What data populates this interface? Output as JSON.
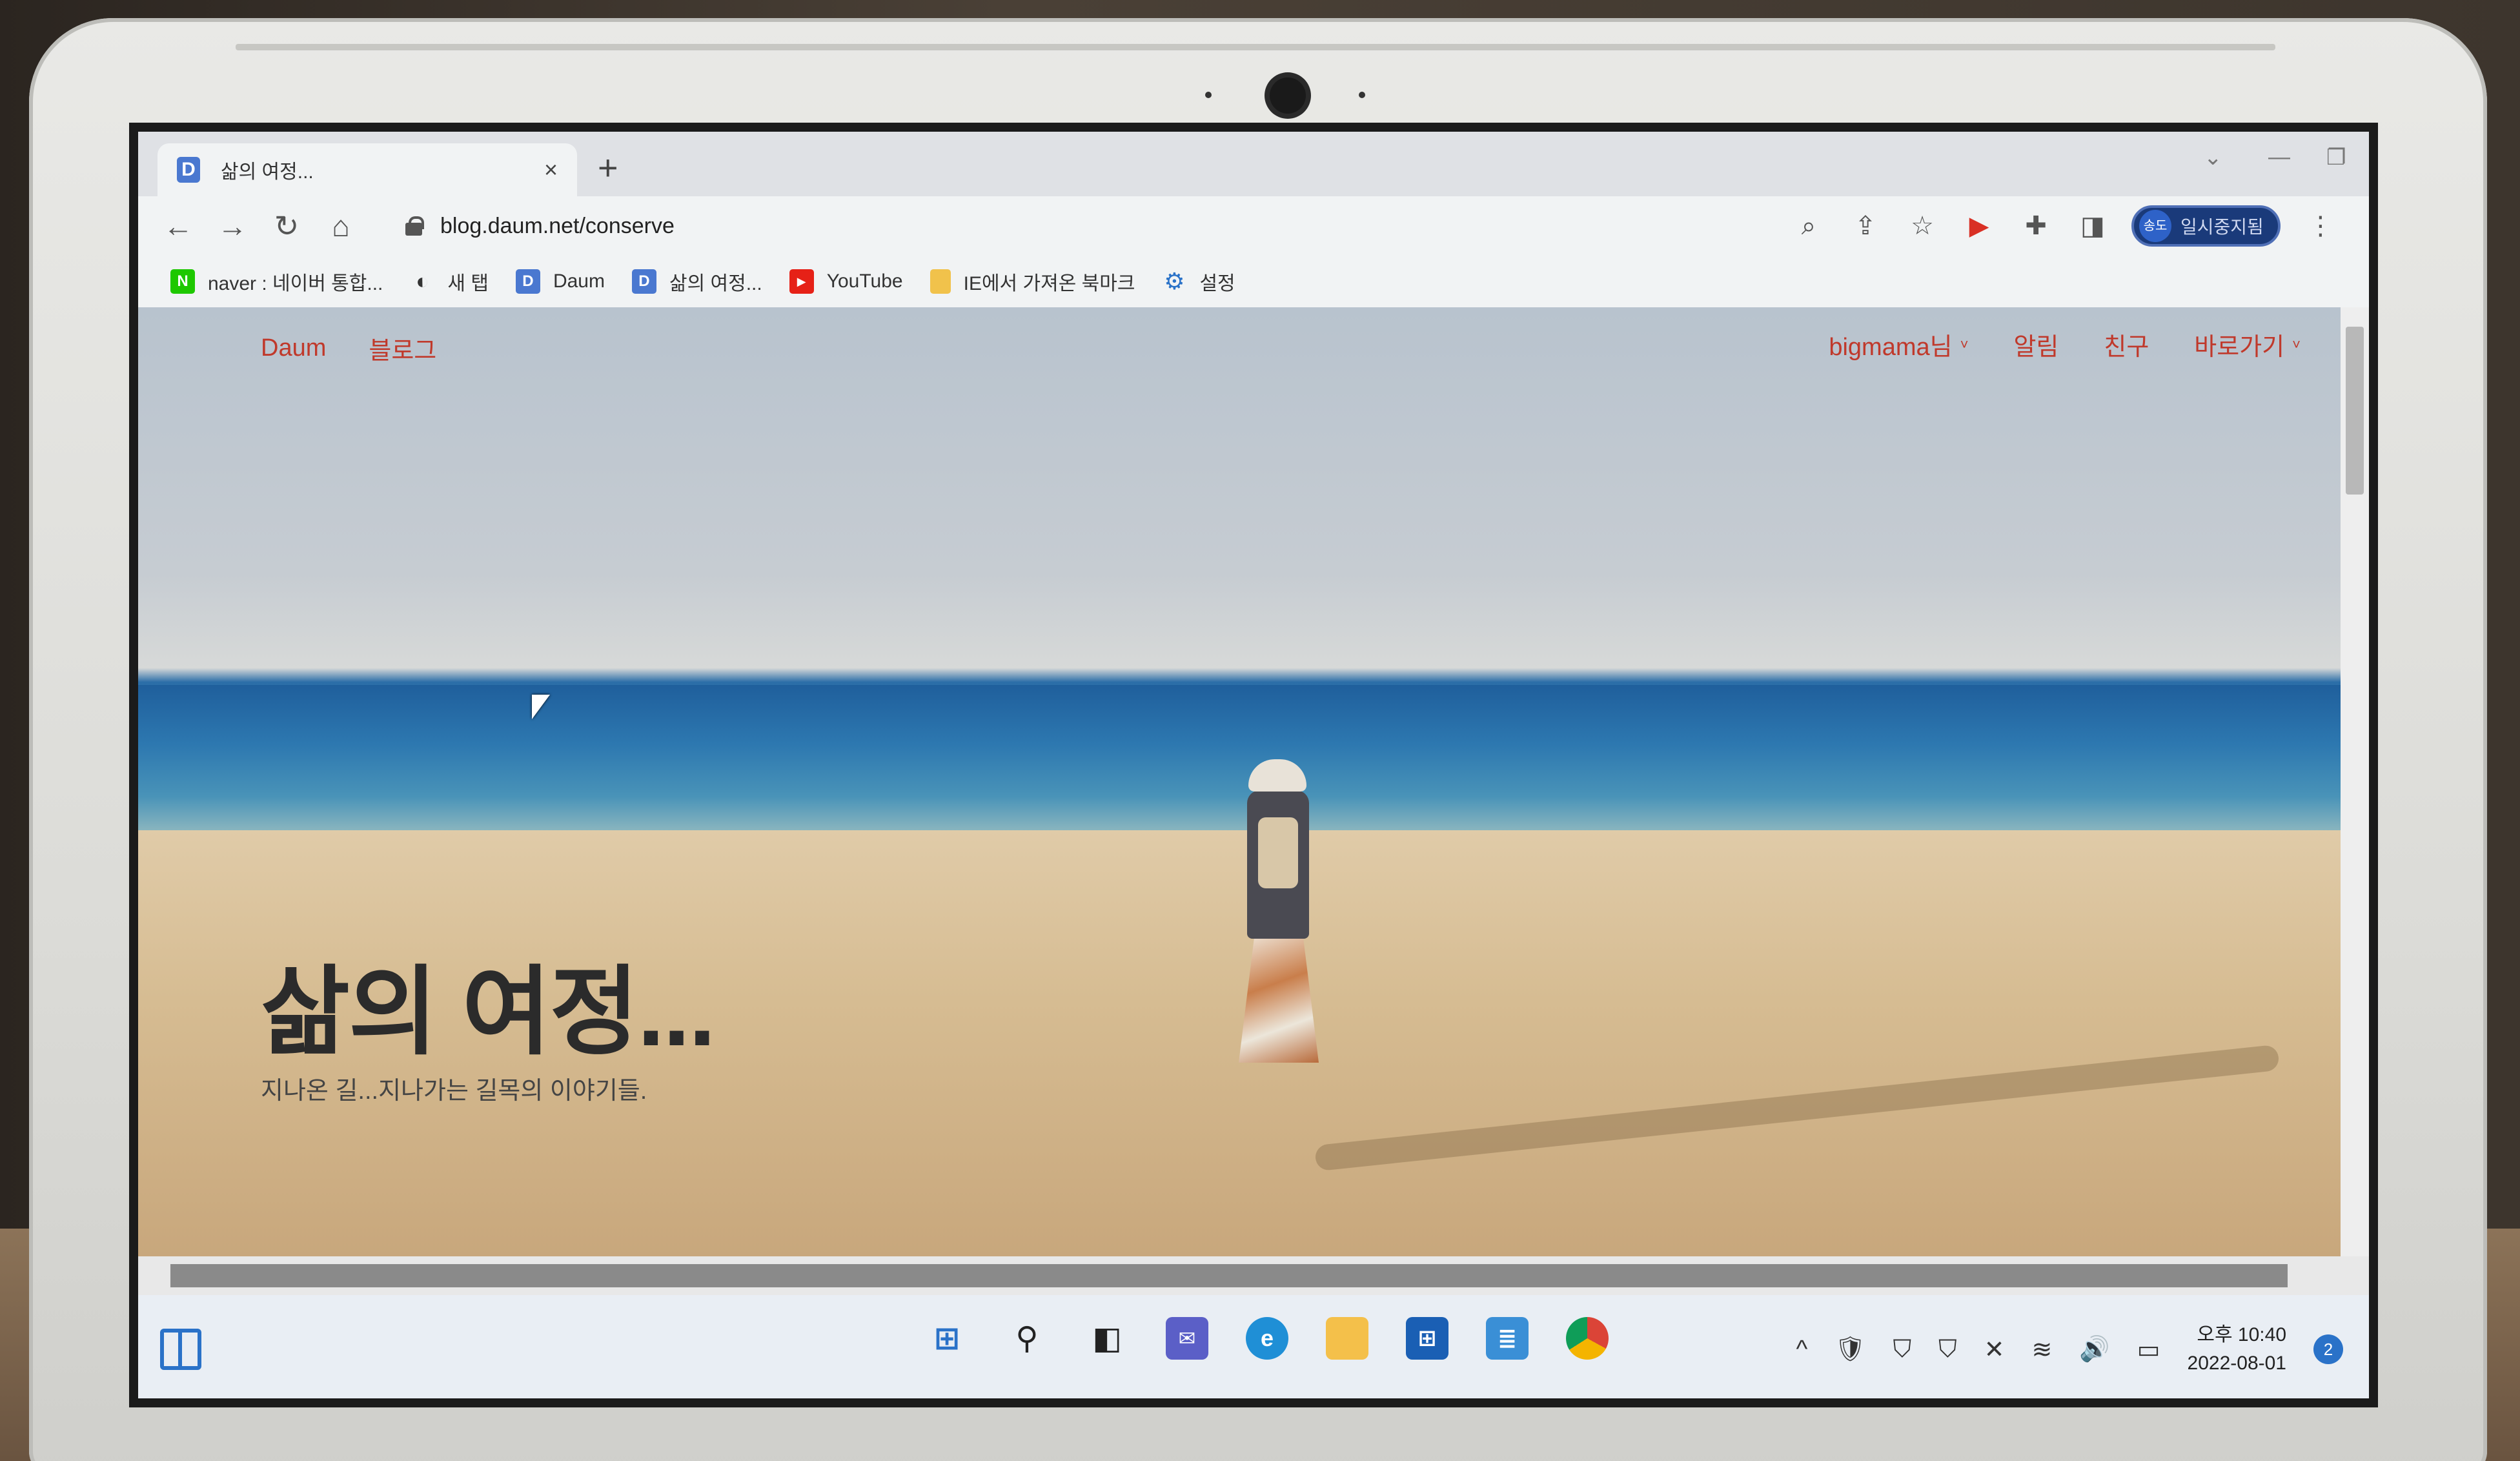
{
  "browser": {
    "tab": {
      "title": "삶의 여정...",
      "favicon": "D",
      "close": "×"
    },
    "new_tab": "+",
    "window_controls": [
      "⌄",
      "—",
      "❐",
      "✕"
    ],
    "url": "blog.daum.net/conserve",
    "nav": {
      "back": "←",
      "forward": "→",
      "reload": "↻",
      "home": "⌂"
    },
    "toolbar_icons": [
      "zoom-icon",
      "share-icon",
      "bookmark-star-icon",
      "extension-red-icon",
      "puzzle-icon",
      "side-panel-icon"
    ],
    "profile": {
      "avatar": "송도",
      "label": "일시중지됨"
    },
    "bookmarks": [
      {
        "label": "naver : 네이버 통합...",
        "icon": "N",
        "color": "#1ec800"
      },
      {
        "label": "새 탭",
        "icon": "◐",
        "color": "#333333"
      },
      {
        "label": "Daum",
        "icon": "D",
        "color": "#4a78d0"
      },
      {
        "label": "삶의 여정...",
        "icon": "D",
        "color": "#4a78d0"
      },
      {
        "label": "YouTube",
        "icon": "▶",
        "color": "#e62117"
      },
      {
        "label": "IE에서 가져온 북마크",
        "icon": "",
        "color": "#f1c24b"
      },
      {
        "label": "설정",
        "icon": "⚙",
        "color": "#2a72c8"
      }
    ]
  },
  "blog": {
    "nav_left": [
      "Daum",
      "블로그"
    ],
    "nav_right": [
      {
        "label": "bigmama님",
        "caret": "˅"
      },
      {
        "label": "알림",
        "caret": ""
      },
      {
        "label": "친구",
        "caret": ""
      },
      {
        "label": "바로가기",
        "caret": "˅"
      }
    ],
    "title": "삶의 여정...",
    "subtitle": "지나온 길...지나가는 길목의 이야기들."
  },
  "taskbar": {
    "apps": [
      "windows-start-icon",
      "search-icon",
      "task-view-icon",
      "chat-icon",
      "edge-icon",
      "file-explorer-icon",
      "store-icon",
      "notepad-icon",
      "chrome-icon"
    ],
    "tray": [
      "^",
      "🛡",
      "⛉",
      "⛉",
      "✕",
      "≋",
      "🔊",
      "▭"
    ],
    "time": "오후 10:40",
    "date": "2022-08-01",
    "notifications": "2"
  },
  "colors": {
    "accent_link": "#c0392b",
    "taskbar_blue": "#2a72c8"
  }
}
